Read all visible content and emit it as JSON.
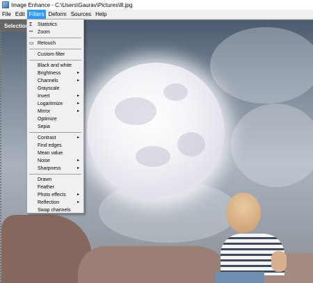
{
  "window": {
    "title": "Image Enhance - C:\\Users\\Gaurav\\Pictures\\lll.jpg"
  },
  "menubar": [
    {
      "label": "File"
    },
    {
      "label": "Edit"
    },
    {
      "label": "Filters"
    },
    {
      "label": "Deform"
    },
    {
      "label": "Sources"
    },
    {
      "label": "Help"
    }
  ],
  "selection_tab": "Selection",
  "filters_menu": {
    "statistics": "Statistics",
    "zoom": "Zoom",
    "retouch": "Retouch",
    "custom_filter": "Custom filter",
    "black_and_white": "Black and white",
    "brightness": "Brightness",
    "channels": "Channels",
    "grayscale": "Grayscale",
    "invert": "Invert",
    "logarithmize": "Logaritmize",
    "mirror": "Mirror",
    "optimize": "Optimize",
    "sepia": "Sepia",
    "contrast": "Contrast",
    "find_edges": "Find edges",
    "mean_value": "Mean value",
    "noise": "Noise",
    "sharpness": "Sharpness",
    "drawn": "Drawn",
    "feather": "Feather",
    "photo_effects": "Photo effects",
    "reflection": "Reflection",
    "swap_channels": "Swap channels",
    "submenu_arrow": "▸"
  },
  "icons": {
    "statistics": "Σ",
    "zoom": "🔍",
    "retouch": "▭"
  },
  "colors": {
    "menu_highlight": "#3399ff"
  }
}
